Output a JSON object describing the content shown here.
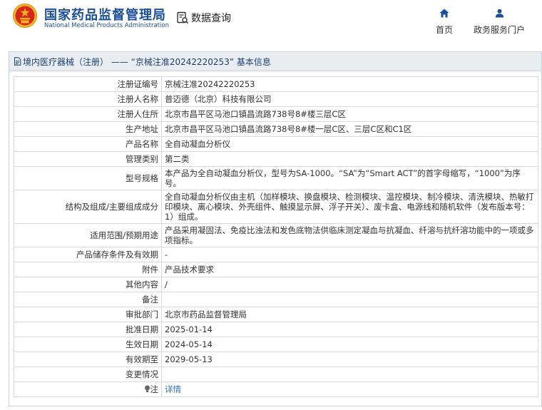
{
  "header": {
    "org_name_cn": "国家药品监督管理局",
    "org_name_en": "National Medical Products Administration",
    "search_label": "数据查询",
    "nav": {
      "home": "首页",
      "gov_portal": "政务服务门户"
    }
  },
  "panel": {
    "title": "境内医疗器械（注册） —— “京械注准20242220253” 基本信息"
  },
  "rows": [
    {
      "key": "注册证编号",
      "value": "京械注准20242220253"
    },
    {
      "key": "注册人名称",
      "value": "普迈德（北京）科技有限公司"
    },
    {
      "key": "注册人住所",
      "value": "北京市昌平区马池口镇昌流路738号8#楼三层C区"
    },
    {
      "key": "生产地址",
      "value": "北京市昌平区马池口镇昌流路738号8#楼一层C区、三层C区和C1区"
    },
    {
      "key": "产品名称",
      "value": "全自动凝血分析仪"
    },
    {
      "key": "管理类别",
      "value": "第二类"
    },
    {
      "key": "型号规格",
      "value": "本产品为全自动凝血分析仪，型号为SA-1000。“SA”为“Smart ACT”的首字母缩写，“1000”为序号。"
    },
    {
      "key": "结构及组成/主要组成成分",
      "value": "全自动凝血分析仪由主机（加样模块、换盘模块、检测模块、温控模块、制冷模块、清洗模块、热敏打印模块、离心模块、外壳组件、触摸显示屏、浮子开关）、废卡盒、电源线和随机软件（发布版本号：1）组成。"
    },
    {
      "key": "适用范围/预期用途",
      "value": "产品采用凝固法、免疫比浊法和发色底物法供临床测定凝血与抗凝血、纤溶与抗纤溶功能中的一项或多项指标。"
    },
    {
      "key": "产品储存条件及有效期",
      "value": "-"
    },
    {
      "key": "附件",
      "value": "产品技术要求"
    },
    {
      "key": "其他内容",
      "value": "/"
    },
    {
      "key": "备注",
      "value": ""
    },
    {
      "key": "审批部门",
      "value": "北京市药品监督管理局"
    },
    {
      "key": "批准日期",
      "value": "2025-01-14"
    },
    {
      "key": "生效日期",
      "value": "2024-05-14"
    },
    {
      "key": "有效期至",
      "value": "2029-05-13"
    },
    {
      "key": "变更情况",
      "value": ""
    }
  ],
  "note_row": {
    "key": "注",
    "link": "详情"
  },
  "colors": {
    "brand_blue": "#1a4f9c",
    "emblem_red": "#d7261e",
    "emblem_gold": "#f2b51c",
    "link": "#2a6fc9"
  }
}
